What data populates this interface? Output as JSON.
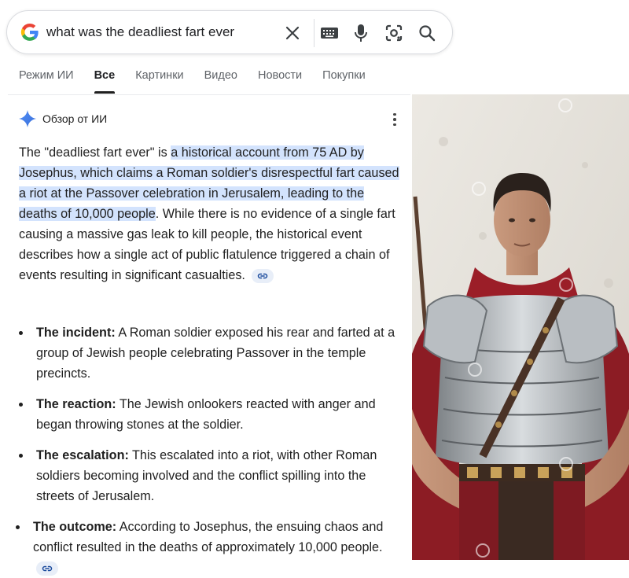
{
  "search": {
    "query": "what was the deadliest fart ever",
    "icons": [
      "google-logo",
      "clear-icon",
      "keyboard-icon",
      "mic-icon",
      "lens-icon",
      "search-icon"
    ]
  },
  "tabs": [
    {
      "label": "Режим ИИ",
      "active": false
    },
    {
      "label": "Все",
      "active": true
    },
    {
      "label": "Картинки",
      "active": false
    },
    {
      "label": "Видео",
      "active": false
    },
    {
      "label": "Новости",
      "active": false
    },
    {
      "label": "Покупки",
      "active": false
    }
  ],
  "overview": {
    "title": "Обзор от ИИ",
    "intro_pre": "The \"deadliest fart ever\" is ",
    "intro_highlight": "a historical account from 75 AD by Josephus, which claims a Roman soldier's disrespectful fart caused a riot at the Passover celebration in Jerusalem, leading to the deaths of 10,000 people",
    "intro_post": ". While there is no evidence of a single fart causing a massive gas leak to kill people, the historical event describes how a single act of public flatulence triggered a chain of events resulting in significant casualties.",
    "bullets": [
      {
        "heading": "The incident:",
        "text": " A Roman soldier exposed his rear and farted at a group of Jewish people celebrating Passover in the temple precincts."
      },
      {
        "heading": "The reaction:",
        "text": " The Jewish onlookers reacted with anger and began throwing stones at the soldier."
      },
      {
        "heading": "The escalation:",
        "text": " This escalated into a riot, with other Roman soldiers becoming involved and the conflict spilling into the streets of Jerusalem."
      },
      {
        "heading": "The outcome:",
        "text": " According to Josephus, the ensuing chaos and conflict resulted in the deaths of approximately 10,000 people."
      }
    ]
  },
  "colors": {
    "highlight": "#d3e3fd",
    "google_blue": "#4285f4",
    "google_red": "#ea4335",
    "google_yellow": "#fbbc05",
    "google_green": "#34a853"
  }
}
